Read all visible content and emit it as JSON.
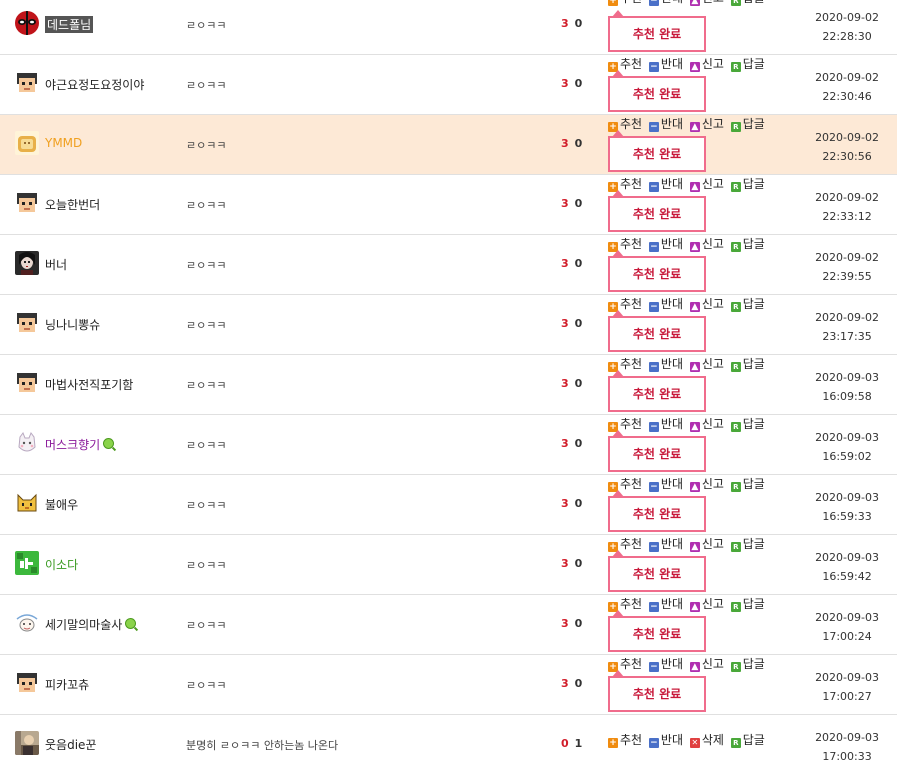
{
  "labels": {
    "recommend": "추천",
    "oppose": "반대",
    "report": "신고",
    "reply": "답글",
    "delete": "삭제",
    "recommend_done": "추천 완료"
  },
  "colors": {
    "up_count": "#d11d2a",
    "popup_border": "#f06c8c",
    "highlight_row": "#fde9d6"
  },
  "rows": [
    {
      "nick": "데드폴님",
      "comment": "ㄹㅇㅋㅋ",
      "up": "3",
      "down": "0",
      "date": "2020-09-02",
      "time": "22:28:30",
      "avatar": "deadpool-icon"
    },
    {
      "nick": "야근요정도요정이야",
      "comment": "ㄹㅇㅋㅋ",
      "up": "3",
      "down": "0",
      "date": "2020-09-02",
      "time": "22:30:46",
      "avatar": "pixel-face-icon"
    },
    {
      "nick": "YMMD",
      "comment": "ㄹㅇㅋㅋ",
      "up": "3",
      "down": "0",
      "date": "2020-09-02",
      "time": "22:30:56",
      "avatar": "bread-icon"
    },
    {
      "nick": "오늘한번더",
      "comment": "ㄹㅇㅋㅋ",
      "up": "3",
      "down": "0",
      "date": "2020-09-02",
      "time": "22:33:12",
      "avatar": "pixel-face-icon"
    },
    {
      "nick": "버너",
      "comment": "ㄹㅇㅋㅋ",
      "up": "3",
      "down": "0",
      "date": "2020-09-02",
      "time": "22:39:55",
      "avatar": "dark-portrait-icon"
    },
    {
      "nick": "닝나니뽕슈",
      "comment": "ㄹㅇㅋㅋ",
      "up": "3",
      "down": "0",
      "date": "2020-09-02",
      "time": "23:17:35",
      "avatar": "pixel-face-icon"
    },
    {
      "nick": "마법사전직포기함",
      "comment": "ㄹㅇㅋㅋ",
      "up": "3",
      "down": "0",
      "date": "2020-09-03",
      "time": "16:09:58",
      "avatar": "pixel-face-icon"
    },
    {
      "nick": "머스크향기",
      "comment": "ㄹㅇㅋㅋ",
      "up": "3",
      "down": "0",
      "date": "2020-09-03",
      "time": "16:59:02",
      "avatar": "white-cat-icon"
    },
    {
      "nick": "불애우",
      "comment": "ㄹㅇㅋㅋ",
      "up": "3",
      "down": "0",
      "date": "2020-09-03",
      "time": "16:59:33",
      "avatar": "fox-icon"
    },
    {
      "nick": "이소다",
      "comment": "ㄹㅇㅋㅋ",
      "up": "3",
      "down": "0",
      "date": "2020-09-03",
      "time": "16:59:42",
      "avatar": "green-tile-icon"
    },
    {
      "nick": "세기말의마술사",
      "comment": "ㄹㅇㅋㅋ",
      "up": "3",
      "down": "0",
      "date": "2020-09-03",
      "time": "17:00:24",
      "avatar": "sketch-icon"
    },
    {
      "nick": "피카꼬츄",
      "comment": "ㄹㅇㅋㅋ",
      "up": "3",
      "down": "0",
      "date": "2020-09-03",
      "time": "17:00:27",
      "avatar": "pixel-face-icon"
    },
    {
      "nick": "웃음die꾼",
      "comment": "분명히 ㄹㅇㅋㅋ 안하는놈 나온다",
      "up": "0",
      "down": "1",
      "date": "2020-09-03",
      "time": "17:00:33",
      "avatar": "photo-icon"
    }
  ]
}
